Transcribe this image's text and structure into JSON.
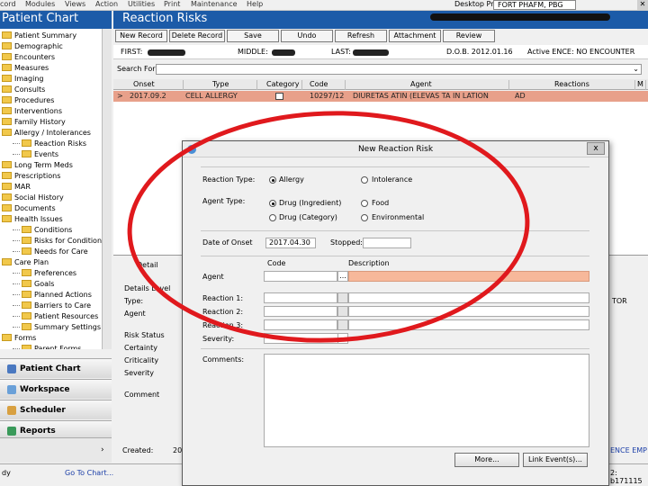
{
  "menu": [
    "cord",
    "Modules",
    "Views",
    "Action",
    "Utilities",
    "Print",
    "Maintenance",
    "Help"
  ],
  "provider": {
    "label": "Desktop Provider:",
    "value": "FORT PHAFM, PBG"
  },
  "left": {
    "title": "Patient Chart",
    "tree": [
      {
        "label": "Patient Summary",
        "level": 0
      },
      {
        "label": "Demographic",
        "level": 0
      },
      {
        "label": "Encounters",
        "level": 0
      },
      {
        "label": "Measures",
        "level": 0
      },
      {
        "label": "Imaging",
        "level": 0
      },
      {
        "label": "Consults",
        "level": 0
      },
      {
        "label": "Procedures",
        "level": 0
      },
      {
        "label": "Interventions",
        "level": 0
      },
      {
        "label": "Family History",
        "level": 0
      },
      {
        "label": "Allergy / Intolerances",
        "level": 0
      },
      {
        "label": "Reaction Risks",
        "level": 1
      },
      {
        "label": "Events",
        "level": 1
      },
      {
        "label": "Long Term Meds",
        "level": 0
      },
      {
        "label": "Prescriptions",
        "level": 0
      },
      {
        "label": "MAR",
        "level": 0
      },
      {
        "label": "Social History",
        "level": 0
      },
      {
        "label": "Documents",
        "level": 0
      },
      {
        "label": "Health Issues",
        "level": 0
      },
      {
        "label": "Conditions",
        "level": 1
      },
      {
        "label": "Risks for Conditions",
        "level": 1
      },
      {
        "label": "Needs for Care",
        "level": 1
      },
      {
        "label": "Care Plan",
        "level": 0
      },
      {
        "label": "Preferences",
        "level": 1
      },
      {
        "label": "Goals",
        "level": 1
      },
      {
        "label": "Planned Actions",
        "level": 1
      },
      {
        "label": "Barriers to Care",
        "level": 1
      },
      {
        "label": "Patient Resources",
        "level": 1
      },
      {
        "label": "Summary Settings",
        "level": 1
      },
      {
        "label": "Forms",
        "level": 0
      },
      {
        "label": "Parent Forms",
        "level": 1
      }
    ],
    "nav": [
      "Patient Chart",
      "Workspace",
      "Scheduler",
      "Reports"
    ],
    "nav_colors": [
      "#4a78c0",
      "#6aa0d8",
      "#d8a040",
      "#3a9a5a"
    ]
  },
  "main": {
    "title": "Reaction Risks",
    "toolbar": [
      "New Record",
      "Delete Record",
      "Save",
      "Undo",
      "Refresh",
      "Attachment",
      "Review"
    ],
    "patient": {
      "first_label": "FIRST:",
      "middle_label": "MIDDLE:",
      "last_label": "LAST:",
      "dob": "D.O.B. 2012.01.16",
      "encounter": "Active ENCE: NO ENCOUNTER"
    },
    "filter_label": "Search For",
    "columns": [
      "Onset",
      "Type",
      "Category",
      "Code",
      "Agent",
      "Reactions",
      "M"
    ],
    "row": {
      "marker": ">",
      "onset": "2017.09.2",
      "type": "CELL ALLERGY",
      "code": "10297/12",
      "agent": "DIURETAS ATIN (ELEVAS TA IN LATION",
      "reactions": "AD"
    },
    "row_color": "#e8a08a"
  },
  "detail": {
    "tab": "Detail",
    "labels": [
      "Details Level",
      "Type:",
      "Agent",
      "Risk Status",
      "Certainty",
      "Criticality",
      "Severity",
      "Comment",
      "Created:"
    ],
    "created_value": "20",
    "right_text": "TOR",
    "right_bottom": "ENCE EMP",
    "status_id": "2: b171115"
  },
  "status": {
    "left": "dy",
    "goto": "Go To Chart..."
  },
  "modal": {
    "title": "New Reaction Risk",
    "close": "x",
    "reaction_type_label": "Reaction Type:",
    "reaction_types": [
      "Allergy",
      "Intolerance"
    ],
    "agent_type_label": "Agent Type:",
    "agent_types": [
      "Drug (Ingredient)",
      "Food",
      "Drug (Category)",
      "Environmental"
    ],
    "date_label": "Date of Onset",
    "date_value": "2017.04.30",
    "stopped_label": "Stopped:",
    "code_header": "Code",
    "desc_header": "Description",
    "agent_label": "Agent",
    "agent_lookup": "...",
    "reaction_labels": [
      "Reaction 1:",
      "Reaction 2:",
      "Reaction 3:"
    ],
    "severity_label": "Severity:",
    "comments_label": "Comments:",
    "more": "More...",
    "link": "Link Event(s)...",
    "agent_desc_color": "#f7b89a"
  },
  "annotation_color": "#e0191d"
}
